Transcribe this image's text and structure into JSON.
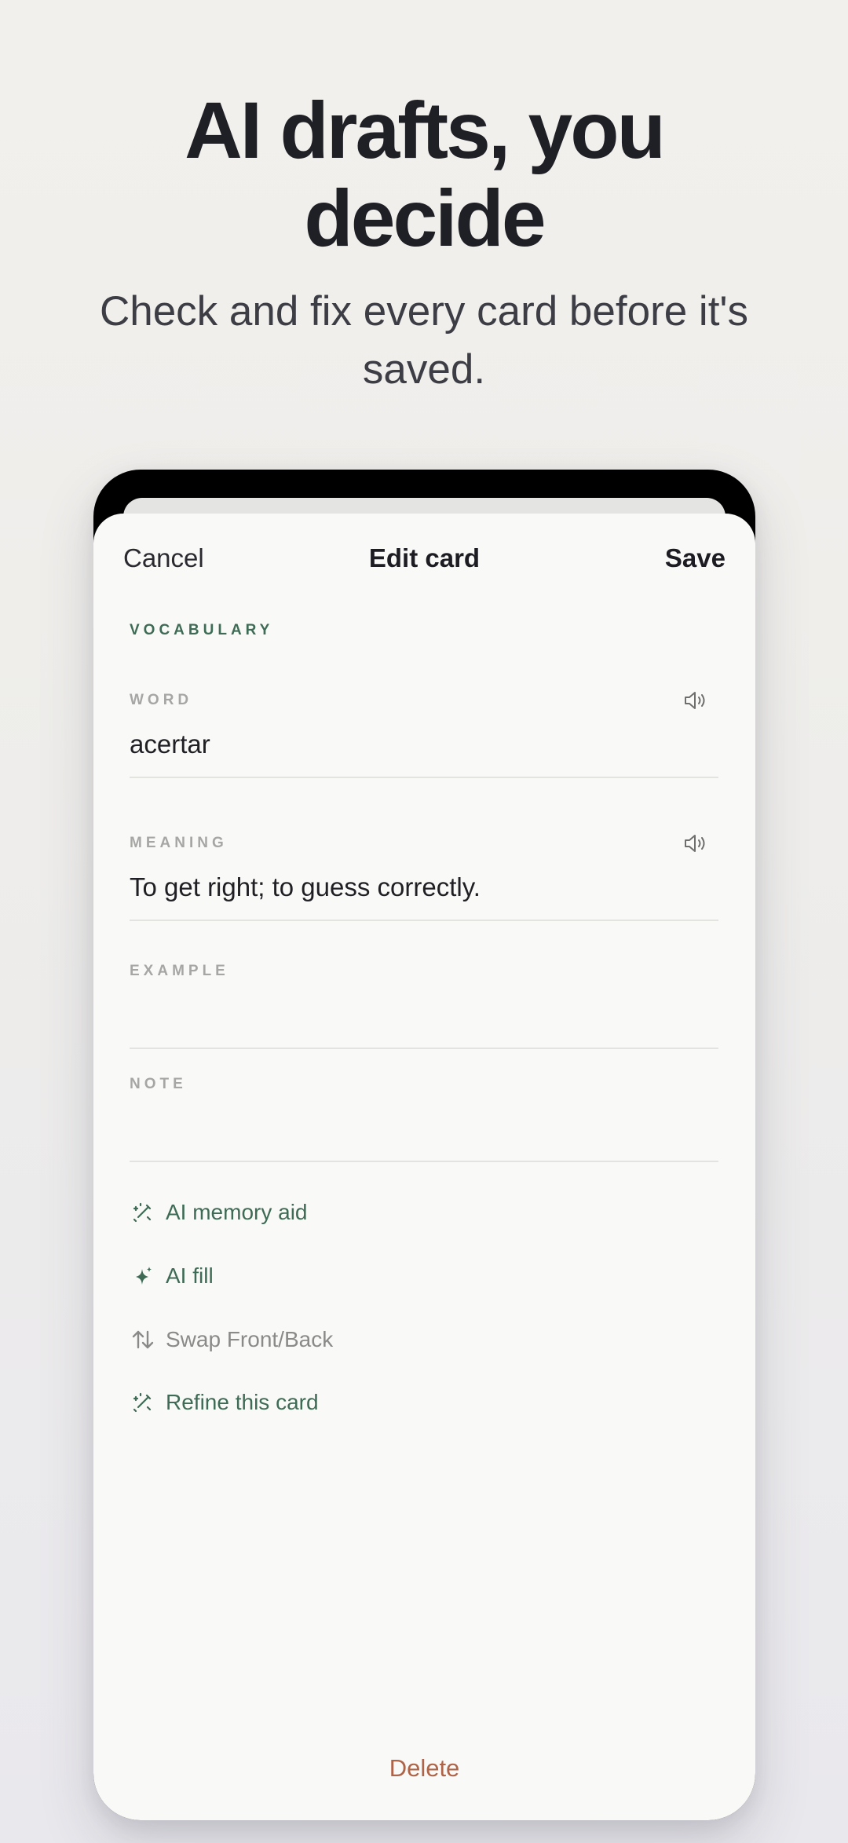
{
  "hero": {
    "title": "AI drafts, you decide",
    "subtitle": "Check and fix every card before it's saved."
  },
  "nav": {
    "cancel": "Cancel",
    "title": "Edit card",
    "save": "Save"
  },
  "card": {
    "type_label": "VOCABULARY",
    "fields": [
      {
        "label": "WORD",
        "value": "acertar",
        "icon": "speaker-icon"
      },
      {
        "label": "MEANING",
        "value": "To get right; to guess correctly.",
        "icon": "speaker-icon"
      },
      {
        "label": "EXAMPLE",
        "value": ""
      },
      {
        "label": "NOTE",
        "value": ""
      }
    ]
  },
  "actions": [
    {
      "label": "AI memory aid",
      "icon": "magic-wand-icon"
    },
    {
      "label": "AI fill",
      "icon": "sparkle-icon"
    },
    {
      "label": "Swap Front/Back",
      "icon": "swap-arrows-icon"
    },
    {
      "label": "Refine this card",
      "icon": "magic-wand-icon"
    }
  ],
  "footer": {
    "delete": "Delete"
  },
  "colors": {
    "accent": "#3e6b55",
    "destructive": "#b06447",
    "muted_label": "#a6a6a4",
    "sheet_background": "#f9f9f7"
  }
}
